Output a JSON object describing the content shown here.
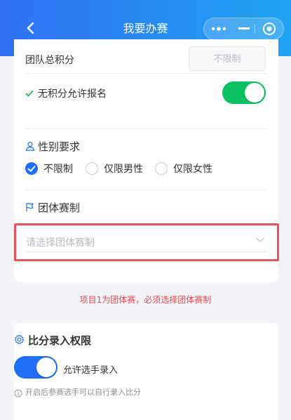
{
  "header": {
    "title": "我要办赛",
    "back_icon": "back-arrow-icon",
    "menu_icons": [
      "more-dots-icon",
      "minimize-icon",
      "close-target-icon"
    ]
  },
  "team_score": {
    "label": "团队总积分",
    "value": "不限制"
  },
  "no_score": {
    "label": "无积分允许报名",
    "enabled": true
  },
  "gender": {
    "title": "性别要求",
    "options": [
      "不限制",
      "仅限男性",
      "仅限女性"
    ],
    "selected": "不限制"
  },
  "team_format": {
    "title": "团体赛制",
    "placeholder": "请选择团体赛制"
  },
  "error_message": "项目1为团体赛，必须选择团体赛制",
  "score_entry": {
    "title": "比分录入权限",
    "toggle_label": "允许选手录入",
    "enabled": true,
    "hint": "开启后参赛选手可以自行录入比分"
  },
  "colors": {
    "header_start": "#2f6ff0",
    "header_end": "#1fa3f2",
    "accent": "#1e6ff5",
    "toggle_green": "#07c160",
    "error": "#e8454b"
  }
}
